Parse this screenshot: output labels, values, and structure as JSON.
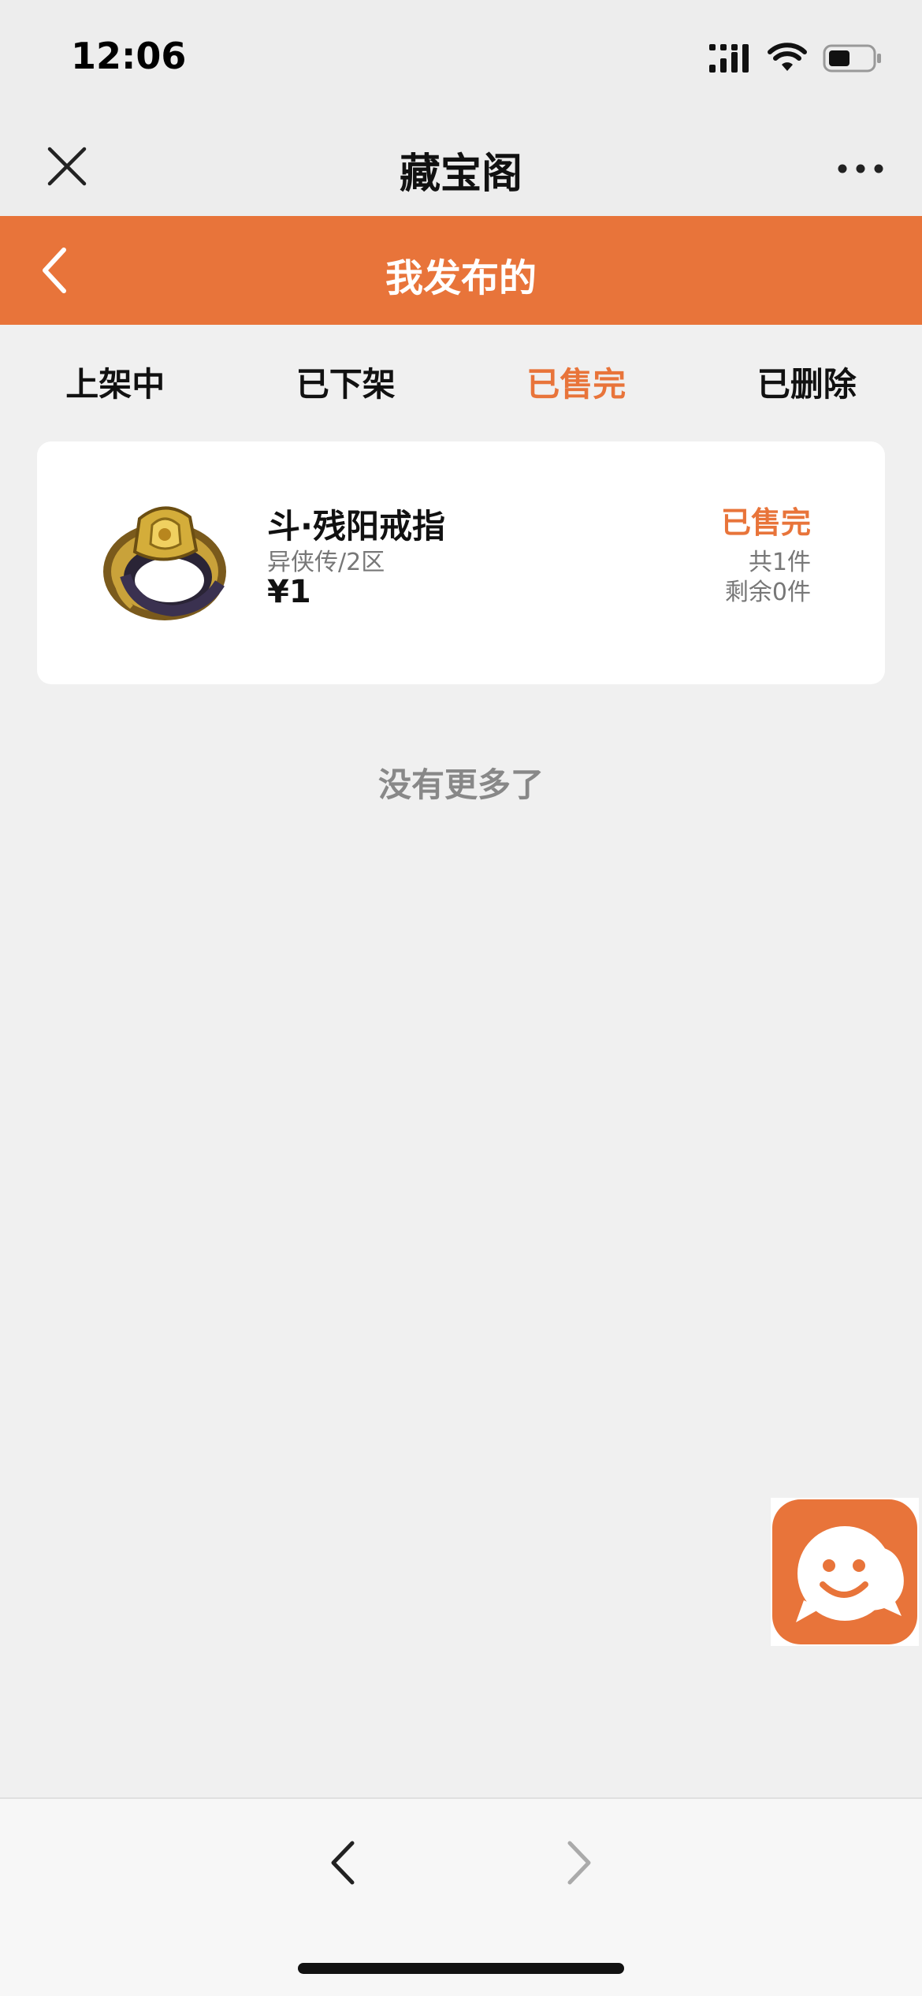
{
  "status_bar": {
    "time": "12:06",
    "icons": [
      "signal-icon",
      "wifi-icon",
      "battery-icon"
    ]
  },
  "title_bar": {
    "title": "藏宝阁",
    "close_icon": "close-icon",
    "more_icon": "more-icon"
  },
  "header": {
    "title": "我发布的",
    "back_icon": "chevron-left-icon"
  },
  "tabs": [
    {
      "label": "上架中",
      "active": false
    },
    {
      "label": "已下架",
      "active": false
    },
    {
      "label": "已售完",
      "active": true
    },
    {
      "label": "已删除",
      "active": false
    }
  ],
  "items": [
    {
      "name": "斗·残阳戒指",
      "server": "异侠传/2区",
      "price": "¥1",
      "status": "已售完",
      "total": "共1件",
      "remaining": "剩余0件",
      "image_icon": "ring-icon"
    }
  ],
  "no_more_text": "没有更多了",
  "chat_fab_icon": "chat-icon",
  "bottom_nav": {
    "back_icon": "nav-back-icon",
    "forward_icon": "nav-forward-icon"
  },
  "colors": {
    "accent": "#e8743a",
    "background": "#f0f0f0",
    "card": "#ffffff"
  }
}
